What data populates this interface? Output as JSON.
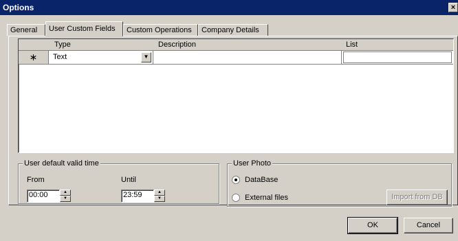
{
  "window": {
    "title": "Options",
    "close_glyph": "×"
  },
  "tabs": [
    {
      "label": "General",
      "active": false
    },
    {
      "label": "User Custom Fields",
      "active": true
    },
    {
      "label": "Custom Operations",
      "active": false
    },
    {
      "label": "Company Details",
      "active": false
    }
  ],
  "grid": {
    "columns": [
      "Type",
      "Description",
      "List"
    ],
    "new_row": {
      "indicator": "∗",
      "type": "Text",
      "description": "",
      "list": ""
    }
  },
  "valid_time": {
    "legend": "User default valid time",
    "from_label": "From",
    "from_value": "00:00",
    "until_label": "Until",
    "until_value": "23:59"
  },
  "photo": {
    "legend": "User Photo",
    "options": [
      {
        "label": "DataBase",
        "checked": true
      },
      {
        "label": "External files",
        "checked": false
      }
    ],
    "import_label": "Import from DB"
  },
  "footer": {
    "ok_label": "OK",
    "cancel_label": "Cancel"
  }
}
